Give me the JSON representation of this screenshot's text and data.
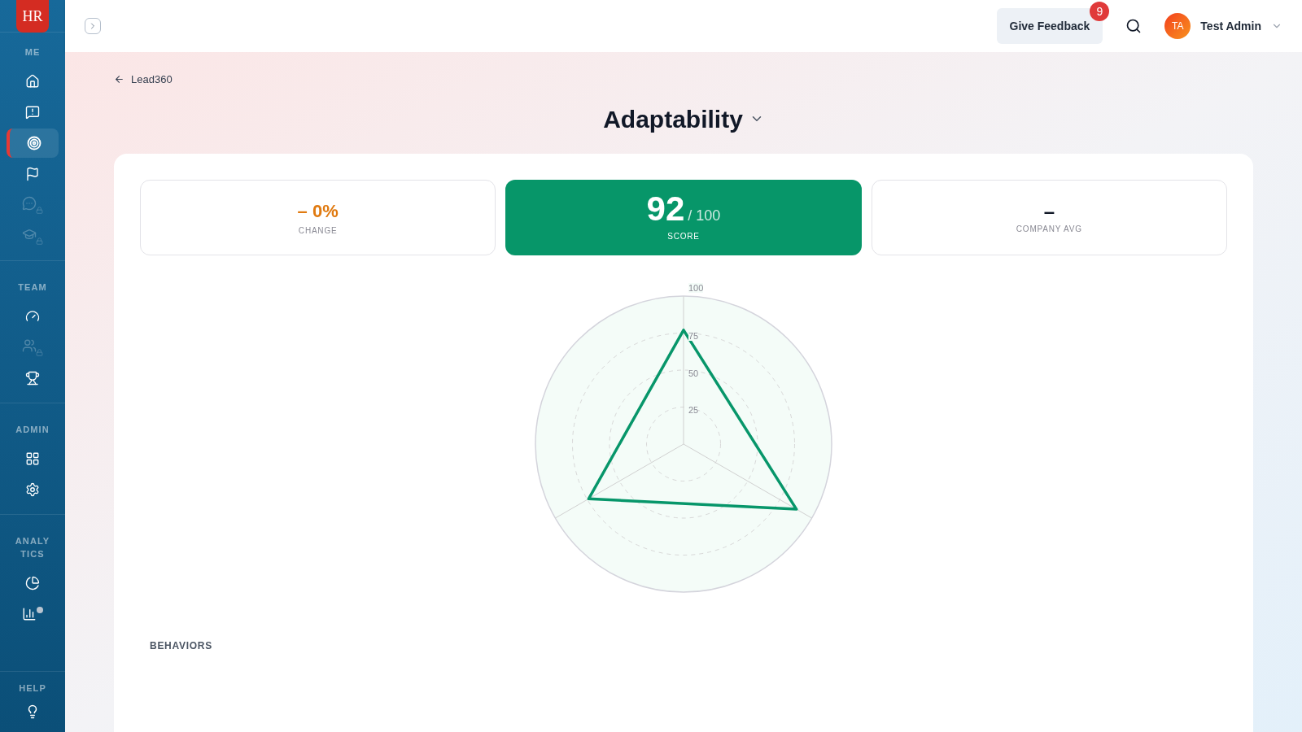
{
  "sidebar": {
    "logo": "HR",
    "sections": [
      {
        "label": "ME",
        "items": [
          {
            "selected": false,
            "disabled": false
          },
          {
            "selected": false,
            "disabled": false
          },
          {
            "selected": true,
            "disabled": false
          },
          {
            "selected": false,
            "disabled": false
          },
          {
            "selected": false,
            "disabled": true
          },
          {
            "selected": false,
            "disabled": true
          }
        ]
      },
      {
        "label": "TEAM",
        "items": [
          {
            "selected": false,
            "disabled": false
          },
          {
            "selected": false,
            "disabled": true
          },
          {
            "selected": false,
            "disabled": false
          }
        ]
      },
      {
        "label": "ADMIN",
        "items": [
          {
            "selected": false,
            "disabled": false
          },
          {
            "selected": false,
            "disabled": false
          }
        ]
      },
      {
        "label": "ANALYTICS",
        "items": [
          {
            "selected": false,
            "disabled": false
          },
          {
            "selected": false,
            "disabled": false
          }
        ]
      }
    ],
    "help": {
      "label": "HELP"
    }
  },
  "topbar": {
    "feedback_button": "Give Feedback",
    "feedback_count": "9",
    "user": {
      "initials": "TA",
      "name": "Test Admin"
    }
  },
  "breadcrumb": "Lead360",
  "title": "Adaptability",
  "stats": {
    "change": {
      "value": "– 0%",
      "label": "CHANGE"
    },
    "score": {
      "value": "92",
      "total": "/ 100",
      "label": "SCORE"
    },
    "company_avg": {
      "value": "–",
      "label": "COMPANY AVG"
    }
  },
  "radar": {
    "kind": "picture",
    "tick_labels": [
      "100",
      "75",
      "50",
      "25"
    ]
  },
  "behaviors_label": "BEHAVIORS"
}
